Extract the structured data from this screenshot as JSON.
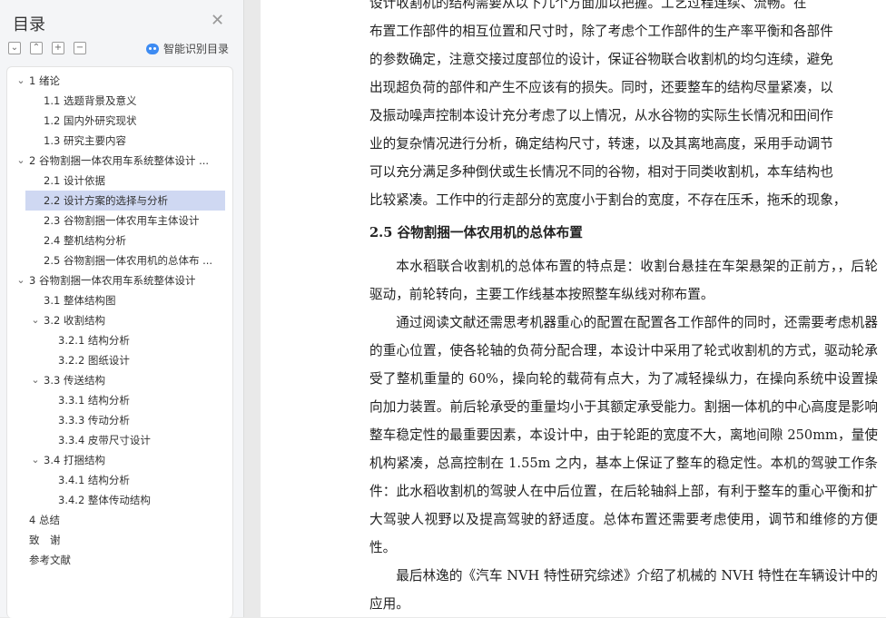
{
  "sidebar": {
    "title": "目录",
    "smart_label": "智能识别目录",
    "toc": [
      {
        "label": "1 绪论",
        "level": 1,
        "caret": true
      },
      {
        "label": "1.1 选题背景及意义",
        "level": 2
      },
      {
        "label": "1.2 国内外研究现状",
        "level": 2
      },
      {
        "label": "1.3 研究主要内容",
        "level": 2
      },
      {
        "label": "2 谷物割捆一体农用车系统整体设计 ...",
        "level": 1,
        "caret": true
      },
      {
        "label": "2.1 设计依据",
        "level": 2
      },
      {
        "label": "2.2  设计方案的选择与分析",
        "level": 2,
        "active": true
      },
      {
        "label": "2.3 谷物割捆一体农用车主体设计",
        "level": 2
      },
      {
        "label": "2.4 整机结构分析",
        "level": 2
      },
      {
        "label": "2.5 谷物割捆一体农用机的总体布 ...",
        "level": 2
      },
      {
        "label": "3 谷物割捆一体农用车系统整体设计",
        "level": 1,
        "caret": true
      },
      {
        "label": "3.1 整体结构图",
        "level": 2
      },
      {
        "label": "3.2 收割结构",
        "level": 2,
        "caret": true
      },
      {
        "label": "3.2.1 结构分析",
        "level": 3
      },
      {
        "label": "3.2.2 图纸设计",
        "level": 3
      },
      {
        "label": "3.3 传送结构",
        "level": 2,
        "caret": true
      },
      {
        "label": "3.3.1 结构分析",
        "level": 3
      },
      {
        "label": "3.3.3 传动分析",
        "level": 3
      },
      {
        "label": "3.3.4 皮带尺寸设计",
        "level": 3
      },
      {
        "label": "3.4 打捆结构",
        "level": 2,
        "caret": true
      },
      {
        "label": "3.4.1 结构分析",
        "level": 3
      },
      {
        "label": "3.4.2 整体传动结构",
        "level": 3
      },
      {
        "label": "4 总结",
        "level": 1
      },
      {
        "label": "致　谢",
        "level": 1
      },
      {
        "label": "参考文献",
        "level": 1
      }
    ]
  },
  "document": {
    "para1_lines": [
      "设计收割机的结构需要从以下几个方面加以把握。工艺过程连续、流畅。在",
      "布置工作部件的相互位置和尺寸时，除了考虑个工作部件的生产率平衡和各部件",
      "的参数确定，注意交接过度部位的设计，保证谷物联合收割机的均匀连续，避免",
      "出现超负荷的部件和产生不应该有的损失。同时，还要整车的结构尽量紧凑，以",
      "及振动噪声控制本设计充分考虑了以上情况，从水谷物的实际生长情况和田间作",
      "业的复杂情况进行分析，确定结构尺寸，转速，以及其离地高度，采用手动调节",
      "可以充分满足多种倒伏或生长情况不同的谷物，相对于同类收割机，本车结构也",
      "比较紧凑。工作中的行走部分的宽度小于割台的宽度，不存在压禾，拖禾的现象，"
    ],
    "heading": "2.5 谷物割捆一体农用机的总体布置",
    "para2": "本水稻联合收割机的总体布置的特点是：收割台悬挂在车架悬架的正前方，，后轮驱动，前轮转向，主要工作线基本按照整车纵线对称布置。",
    "para3": "通过阅读文献还需思考机器重心的配置在配置各工作部件的同时，还需要考虑机器的重心位置，使各轮轴的负荷分配合理，本设计中采用了轮式收割机的方式，驱动轮承受了整机重量的 60%，操向轮的载荷有点大，为了减轻操纵力，在操向系统中设置操向加力装置。前后轮承受的重量均小于其额定承受能力。割捆一体机的中心高度是影响整车稳定性的最重要因素，本设计中，由于轮距的宽度不大，离地间隙 250mm，量使机构紧凑，总高控制在 1.55m 之内，基本上保证了整车的稳定性。本机的驾驶工作条件：此水稻收割机的驾驶人在中后位置，在后轮轴斜上部，有利于整车的重心平衡和扩大驾驶人视野以及提高驾驶的舒适度。总体布置还需要考虑使用，调节和维修的方便性。",
    "para4": "最后林逸的《汽车 NVH 特性研究综述》介绍了机械的 NVH 特性在车辆设计中的应用。"
  }
}
